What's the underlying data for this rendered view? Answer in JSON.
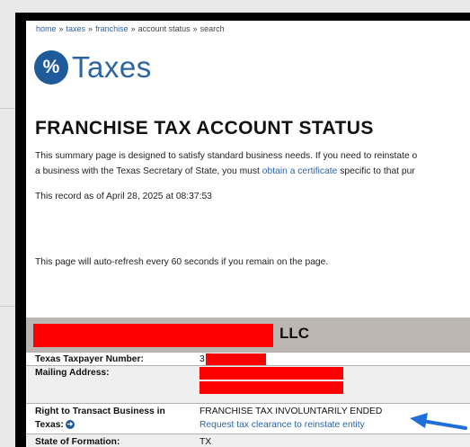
{
  "breadcrumb": [
    {
      "label": "home",
      "link": true
    },
    {
      "label": "taxes",
      "link": true
    },
    {
      "label": "franchise",
      "link": true
    },
    {
      "label": "account status",
      "link": false
    },
    {
      "label": "search",
      "link": false
    }
  ],
  "breadcrumb_separator": "»",
  "logo": {
    "symbol": "%",
    "text": "Taxes"
  },
  "page_title": "FRANCHISE TAX ACCOUNT STATUS",
  "intro": {
    "line1": "This summary page is designed to satisfy standard business needs. If you need to reinstate o",
    "line2_prefix": "a business with the Texas Secretary of State, you must ",
    "line2_link": "obtain a certificate",
    "line2_suffix": " specific to that pur"
  },
  "record_as_of": "This record as of April 28, 2025 at 08:37:53",
  "refresh_note": "This page will auto-refresh every 60 seconds if you remain on the page.",
  "entity": {
    "name_suffix": "LLC"
  },
  "rows": {
    "taxpayer_number": {
      "label": "Texas Taxpayer Number:",
      "value_prefix": "3"
    },
    "mailing_address": {
      "label": "Mailing Address:"
    },
    "right_to_transact": {
      "label_line1": "Right to Transact Business in",
      "label_line2": "Texas:",
      "status": "FRANCHISE TAX INVOLUNTARILY ENDED",
      "link": "Request tax clearance to reinstate entity"
    },
    "state_of_formation": {
      "label": "State of Formation:",
      "value": "TX"
    }
  },
  "colors": {
    "link": "#2b64a5",
    "logo_badge": "#1f5b9a",
    "entity_header_bg": "#bdb5b1",
    "redaction": "#ff0000",
    "annotation_arrow": "#1e6fd9"
  },
  "icons": {
    "info_arrow": "arrow-right-circle-icon",
    "annotation": "pointer-arrow-icon"
  }
}
